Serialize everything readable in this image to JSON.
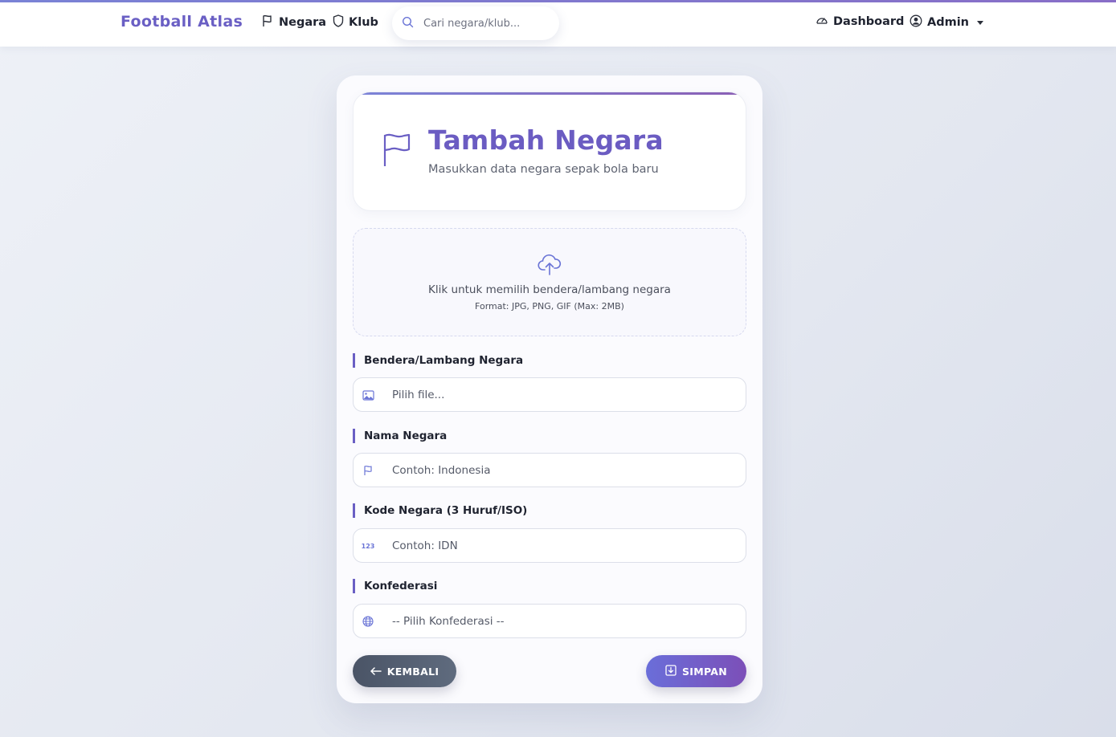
{
  "nav": {
    "brand": "Football Atlas",
    "negara": "Negara",
    "klub": "Klub",
    "search_placeholder": "Cari negara/klub...",
    "dashboard": "Dashboard",
    "admin": "Admin"
  },
  "header": {
    "title": "Tambah Negara",
    "subtitle": "Masukkan data negara sepak bola baru"
  },
  "upload": {
    "text": "Klik untuk memilih bendera/lambang negara",
    "hint": "Format: JPG, PNG, GIF (Max: 2MB)"
  },
  "form": {
    "flag_label": "Bendera/Lambang Negara",
    "flag_value": "Pilih file...",
    "name_label": "Nama Negara",
    "name_placeholder": "Contoh: Indonesia",
    "code_label": "Kode Negara (3 Huruf/ISO)",
    "code_placeholder": "Contoh: IDN",
    "code_icon_text": "123",
    "conf_label": "Konfederasi",
    "conf_value": "-- Pilih Konfederasi --"
  },
  "buttons": {
    "back": "KEMBALI",
    "save": "SIMPAN"
  },
  "colors": {
    "accent": "#6a5fc4",
    "back_button": "#4f5a6c",
    "save_button": "#7260c9"
  },
  "icons": [
    "flag-icon",
    "shield-icon",
    "search-icon",
    "dashboard-icon",
    "user-circle-icon",
    "cloud-upload-icon",
    "image-icon",
    "globe-icon",
    "arrow-left-icon",
    "save-icon"
  ]
}
